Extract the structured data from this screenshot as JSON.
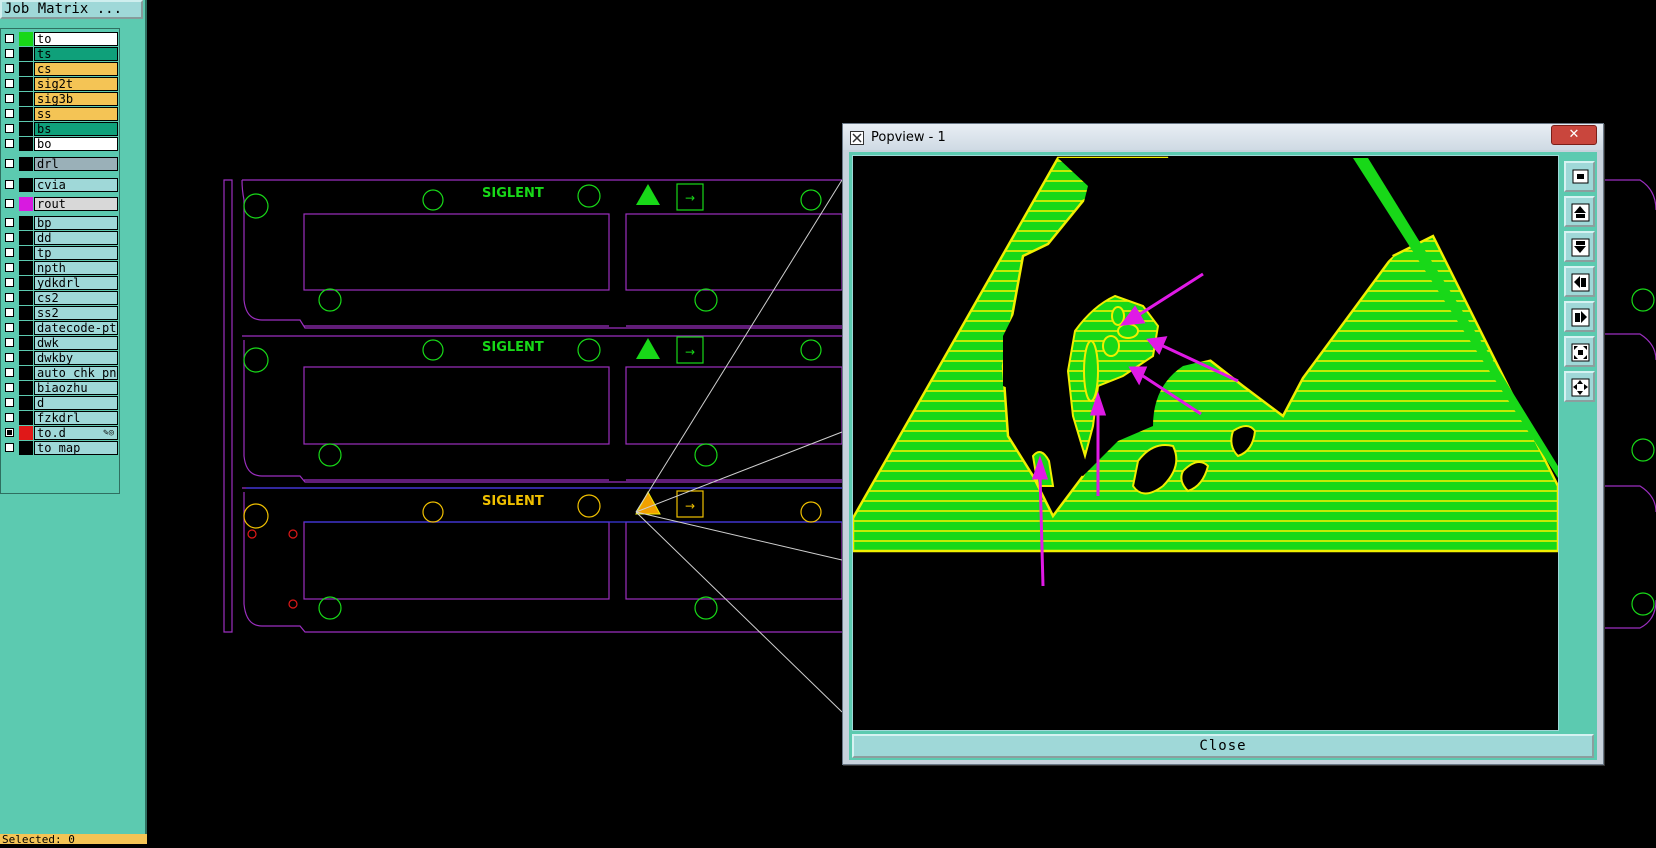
{
  "job_matrix": {
    "title": "Job Matrix ...",
    "layers": [
      {
        "name": "to",
        "bg": "#ffffff",
        "swatch": "#18d818",
        "checked": false
      },
      {
        "name": "ts",
        "bg": "#0fa07a",
        "swatch": "#000000",
        "checked": false
      },
      {
        "name": "cs",
        "bg": "#f4c455",
        "swatch": "#000000",
        "checked": false
      },
      {
        "name": "sig2t",
        "bg": "#f4c455",
        "swatch": "#000000",
        "checked": false
      },
      {
        "name": "sig3b",
        "bg": "#f4c455",
        "swatch": "#000000",
        "checked": false
      },
      {
        "name": "ss",
        "bg": "#f4c455",
        "swatch": "#000000",
        "checked": false
      },
      {
        "name": "bs",
        "bg": "#0fa07a",
        "swatch": "#000000",
        "checked": false
      },
      {
        "name": "bo",
        "bg": "#ffffff",
        "swatch": "#000000",
        "checked": false
      },
      {
        "name": "drl",
        "bg": "#9ab0b8",
        "swatch": "#000000",
        "checked": false
      },
      {
        "name": "cvia",
        "bg": "#9fd8d8",
        "swatch": "#000000",
        "checked": false
      },
      {
        "name": "rout",
        "bg": "#d8d8d8",
        "swatch": "#d81ae0",
        "checked": false
      },
      {
        "name": "bp",
        "bg": "#9fd8d8",
        "swatch": "#000000",
        "checked": false
      },
      {
        "name": "dd",
        "bg": "#9fd8d8",
        "swatch": "#000000",
        "checked": false
      },
      {
        "name": "tp",
        "bg": "#9fd8d8",
        "swatch": "#000000",
        "checked": false
      },
      {
        "name": "npth",
        "bg": "#9fd8d8",
        "swatch": "#000000",
        "checked": false
      },
      {
        "name": "ydkdrl",
        "bg": "#9fd8d8",
        "swatch": "#000000",
        "checked": false
      },
      {
        "name": "cs2",
        "bg": "#9fd8d8",
        "swatch": "#000000",
        "checked": false
      },
      {
        "name": "ss2",
        "bg": "#9fd8d8",
        "swatch": "#000000",
        "checked": false
      },
      {
        "name": "datecode-pte",
        "bg": "#9fd8d8",
        "swatch": "#000000",
        "checked": false
      },
      {
        "name": "dwk",
        "bg": "#9fd8d8",
        "swatch": "#000000",
        "checked": false
      },
      {
        "name": "dwkby",
        "bg": "#9fd8d8",
        "swatch": "#000000",
        "checked": false
      },
      {
        "name": "auto_chk_pnl",
        "bg": "#9fd8d8",
        "swatch": "#000000",
        "checked": false
      },
      {
        "name": "biaozhu",
        "bg": "#9fd8d8",
        "swatch": "#000000",
        "checked": false
      },
      {
        "name": "d",
        "bg": "#9fd8d8",
        "swatch": "#000000",
        "checked": false
      },
      {
        "name": "fzkdrl",
        "bg": "#9fd8d8",
        "swatch": "#000000",
        "checked": false
      },
      {
        "name": "to.d",
        "bg": "#9fd8d8",
        "swatch": "#e01818",
        "checked": true
      },
      {
        "name": "to_map",
        "bg": "#9fd8d8",
        "swatch": "#000000",
        "checked": false
      }
    ],
    "status_text": "Selected: 0"
  },
  "canvas": {
    "panel_brand": "SIGLENT",
    "arrow_glyph": "→"
  },
  "popview": {
    "title": "Popview - 1",
    "close_x": "✕",
    "close_button": "Close",
    "tools": [
      "zoom-window-icon",
      "zoom-in-icon",
      "zoom-out-icon",
      "pan-left-icon",
      "pan-right-icon",
      "fit-view-icon",
      "center-view-icon"
    ]
  },
  "colors": {
    "panel_bg": "#5ccab0",
    "board_outline": "#9b2fbf",
    "copper_green": "#18d818",
    "copper_edge": "#f0f000",
    "annotation_arrow": "#e01ae6"
  }
}
